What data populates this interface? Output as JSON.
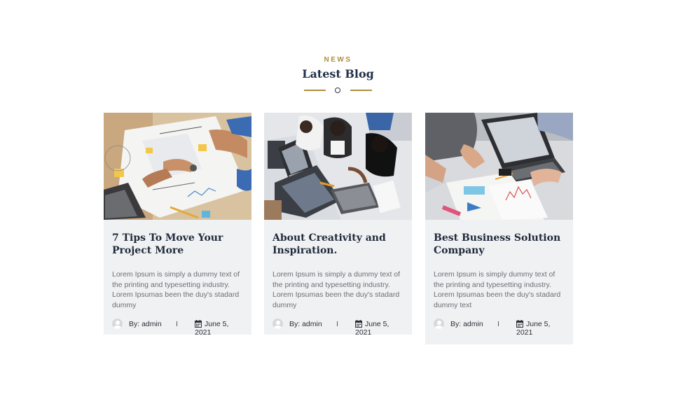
{
  "header": {
    "kicker": "NEWS",
    "title": "Latest Blog"
  },
  "posts": [
    {
      "title": "7 Tips To Move Your Project More",
      "excerpt": "Lorem Ipsum is simply a dummy text of the printing and typesetting industry. Lorem Ipsumas been the duy's stadard dummy",
      "author": "By: admin",
      "date": "June 5, 2021",
      "image": "team-planning-photo"
    },
    {
      "title": "About Creativity and Inspiration.",
      "excerpt": "Lorem Ipsum is simply a dummy text of the printing and typesetting industry. Lorem Ipsumas been the duy's stadard dummy",
      "author": "By: admin",
      "date": "June 5, 2021",
      "image": "office-laptops-photo"
    },
    {
      "title": "Best Business Solution Company",
      "excerpt": "Lorem Ipsum is simply dummy text of the printing and typesetting industry. Lorem Ipsumas been the duy's stadard dummy text",
      "author": "By: admin",
      "date": "June 5, 2021",
      "image": "business-meeting-photo"
    }
  ],
  "colors": {
    "accent": "#b08d3c",
    "heading": "#22304a",
    "card_bg": "#f0f1f3"
  }
}
